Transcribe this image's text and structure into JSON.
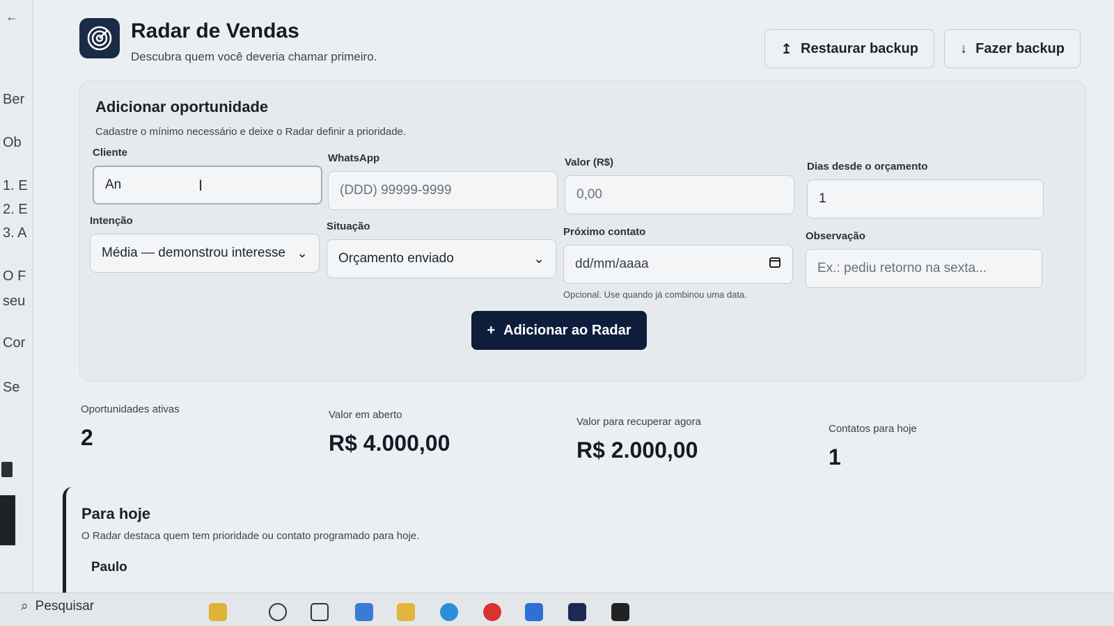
{
  "app": {
    "title": "Radar de Vendas",
    "subtitle": "Descubra quem você deveria chamar primeiro.",
    "restore_label": "Restaurar backup",
    "backup_label": "Fazer backup"
  },
  "form": {
    "title": "Adicionar oportunidade",
    "description": "Cadastre o mínimo necessário e deixe o Radar definir a prioridade.",
    "cliente": {
      "label": "Cliente",
      "value": "An"
    },
    "whatsapp": {
      "label": "WhatsApp",
      "placeholder": "(DDD) 99999-9999"
    },
    "valor": {
      "label": "Valor (R$)",
      "placeholder": "0,00"
    },
    "dias": {
      "label": "Dias desde o orçamento",
      "value": "1"
    },
    "intencao": {
      "label": "Intenção",
      "value": "Média — demonstrou interesse"
    },
    "situacao": {
      "label": "Situação",
      "value": "Orçamento enviado"
    },
    "proximo": {
      "label": "Próximo contato",
      "placeholder": "dd/mm/aaaa",
      "hint": "Opcional. Use quando já combinou uma data."
    },
    "observacao": {
      "label": "Observação",
      "placeholder": "Ex.: pediu retorno na sexta..."
    },
    "submit_label": "Adicionar ao Radar"
  },
  "stats": [
    {
      "label": "Oportunidades ativas",
      "value": "2"
    },
    {
      "label": "Valor em aberto",
      "value": "R$ 4.000,00"
    },
    {
      "label": "Valor para recuperar agora",
      "value": "R$ 2.000,00"
    },
    {
      "label": "Contatos para hoje",
      "value": "1"
    }
  ],
  "today": {
    "title": "Para hoje",
    "description": "O Radar destaca quem tem prioridade ou contato programado para hoje.",
    "first_name": "Paulo"
  },
  "background_window": {
    "lines": [
      "Ber",
      "Ob",
      "1. E",
      "2. E",
      "3. A",
      "O F",
      "seu",
      "Cor",
      "Se"
    ]
  },
  "taskbar": {
    "search_label": "Pesquisar"
  },
  "colors": {
    "primary": "#0f1d3c",
    "logo_bg": "#1a2b46",
    "background": "#eceff1"
  }
}
